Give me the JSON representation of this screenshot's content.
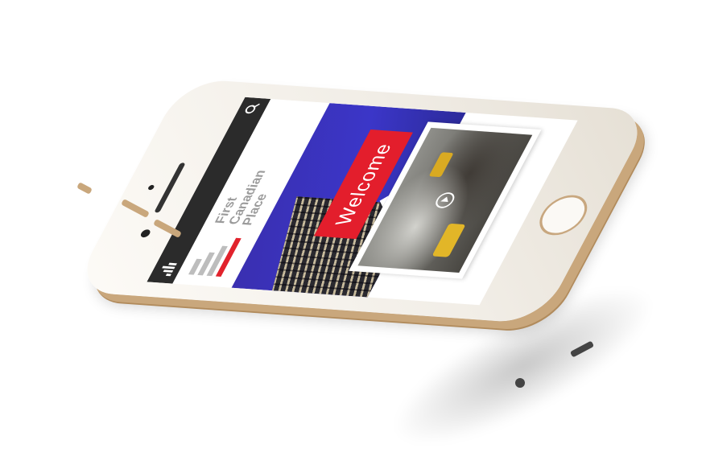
{
  "brand": {
    "name_line1": "First",
    "name_line2": "Canadian",
    "name_line3": "Place"
  },
  "hero": {
    "welcome_text": "Welcome"
  },
  "icons": {
    "menu": "menu-bars-icon",
    "search": "search-icon",
    "play": "play-icon"
  },
  "colors": {
    "accent_red": "#e31e2c",
    "hero_blue": "#3b36c8",
    "topbar": "#2b2b2b",
    "logo_grey": "#bdbdbd",
    "phone_gold": "#c9a77c"
  }
}
